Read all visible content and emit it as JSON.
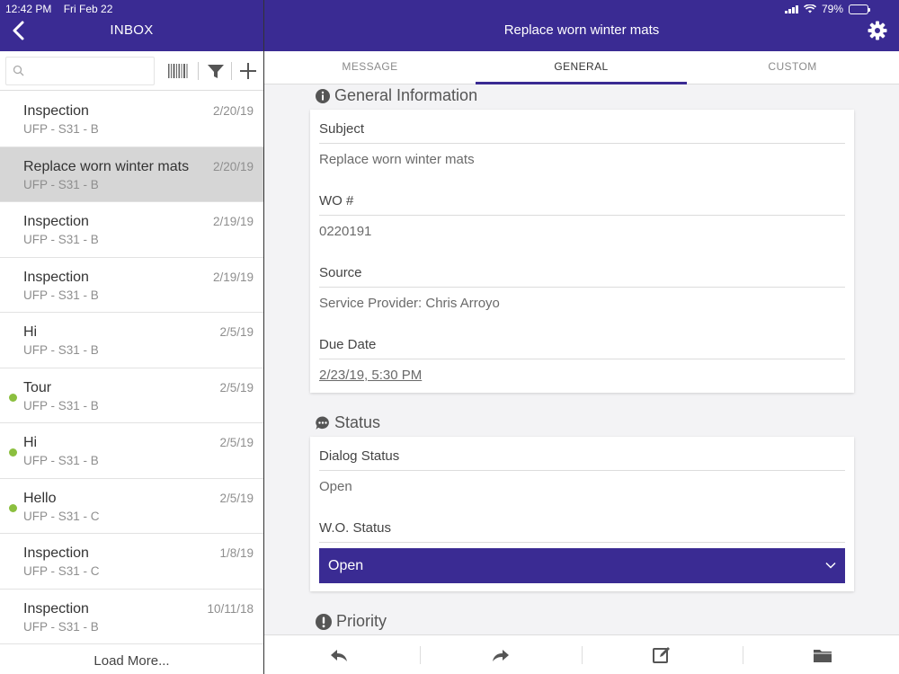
{
  "status_bar": {
    "time": "12:42 PM",
    "date": "Fri Feb 22",
    "battery": "79%",
    "battery_level": 0.79
  },
  "inbox": {
    "title": "INBOX",
    "search_placeholder": "",
    "items": [
      {
        "title": "Inspection",
        "sub": "UFP - S31 - B",
        "date": "2/20/19",
        "unread": false,
        "selected": false
      },
      {
        "title": "Replace worn winter mats",
        "sub": "UFP - S31 - B",
        "date": "2/20/19",
        "unread": false,
        "selected": true
      },
      {
        "title": "Inspection",
        "sub": "UFP - S31 - B",
        "date": "2/19/19",
        "unread": false,
        "selected": false
      },
      {
        "title": "Inspection",
        "sub": "UFP - S31 - B",
        "date": "2/19/19",
        "unread": false,
        "selected": false
      },
      {
        "title": "Hi",
        "sub": "UFP - S31 - B",
        "date": "2/5/19",
        "unread": false,
        "selected": false
      },
      {
        "title": "Tour",
        "sub": "UFP - S31 - B",
        "date": "2/5/19",
        "unread": true,
        "selected": false
      },
      {
        "title": "Hi",
        "sub": "UFP - S31 - B",
        "date": "2/5/19",
        "unread": true,
        "selected": false
      },
      {
        "title": "Hello",
        "sub": "UFP - S31 - C",
        "date": "2/5/19",
        "unread": true,
        "selected": false
      },
      {
        "title": "Inspection",
        "sub": "UFP - S31 - C",
        "date": "1/8/19",
        "unread": false,
        "selected": false
      },
      {
        "title": "Inspection",
        "sub": "UFP - S31 - B",
        "date": "10/11/18",
        "unread": false,
        "selected": false
      }
    ],
    "load_more": "Load More..."
  },
  "detail": {
    "title": "Replace worn winter mats",
    "tabs": [
      "MESSAGE",
      "GENERAL",
      "CUSTOM"
    ],
    "active_tab": 1,
    "general_info": {
      "heading": "General Information",
      "subject_label": "Subject",
      "subject_value": "Replace worn winter mats",
      "wo_label": "WO #",
      "wo_value": "0220191",
      "source_label": "Source",
      "source_value": "Service Provider: Chris Arroyo",
      "due_label": "Due Date",
      "due_value": "2/23/19, 5:30 PM"
    },
    "status": {
      "heading": "Status",
      "dialog_label": "Dialog Status",
      "dialog_value": "Open",
      "wo_status_label": "W.O. Status",
      "wo_status_value": "Open"
    },
    "priority": {
      "heading": "Priority"
    }
  },
  "colors": {
    "brand": "#3a2b93",
    "unread_dot": "#8bbf3f",
    "selected_row": "#d6d6d6"
  },
  "icons": [
    "back-chevron-icon",
    "gear-icon",
    "search-icon",
    "barcode-icon",
    "filter-icon",
    "plus-icon",
    "info-icon",
    "chat-icon",
    "exclamation-icon",
    "reply-icon",
    "forward-icon",
    "edit-icon",
    "folder-icon",
    "chevron-down-icon"
  ]
}
